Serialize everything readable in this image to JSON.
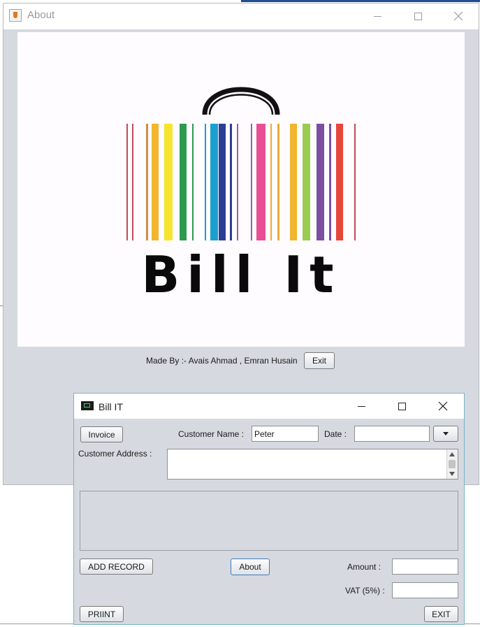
{
  "about_window": {
    "title": "About",
    "logo": {
      "text": "Bill It"
    },
    "credits": "Made By :- Avais Ahmad , Emran Husain",
    "exit_label": "Exit"
  },
  "bill_window": {
    "title": "Bill IT",
    "invoice_label": "Invoice",
    "customer_name_label": "Customer Name :",
    "customer_name_value": "Peter",
    "date_label": "Date :",
    "date_value": "",
    "customer_address_label": "Customer Address :",
    "customer_address_value": "",
    "add_record_label": "ADD RECORD",
    "about_label": "About",
    "amount_label": "Amount :",
    "amount_value": "",
    "vat_label": "VAT (5%) :",
    "vat_value": "",
    "print_label": "PRIINT",
    "exit_label": "EXIT"
  },
  "icons": {
    "about_app": "java-cup-icon",
    "bill_app": "terminal-icon",
    "minimize": "minimize-icon",
    "maximize": "maximize-icon",
    "close": "close-icon",
    "dropdown": "chevron-down-icon"
  },
  "colors": {
    "barcode": [
      "#c44a5b",
      "#d78a4a",
      "#f2b52e",
      "#f7e52d",
      "#2d9a4f",
      "#1aa0cf",
      "#2c3d95",
      "#9b59b6",
      "#e94f95",
      "#f0a73a",
      "#9acb53",
      "#7d4fa1",
      "#e7463a"
    ],
    "window_bg": "#d6d9df",
    "bill_border": "#77b6c4"
  }
}
